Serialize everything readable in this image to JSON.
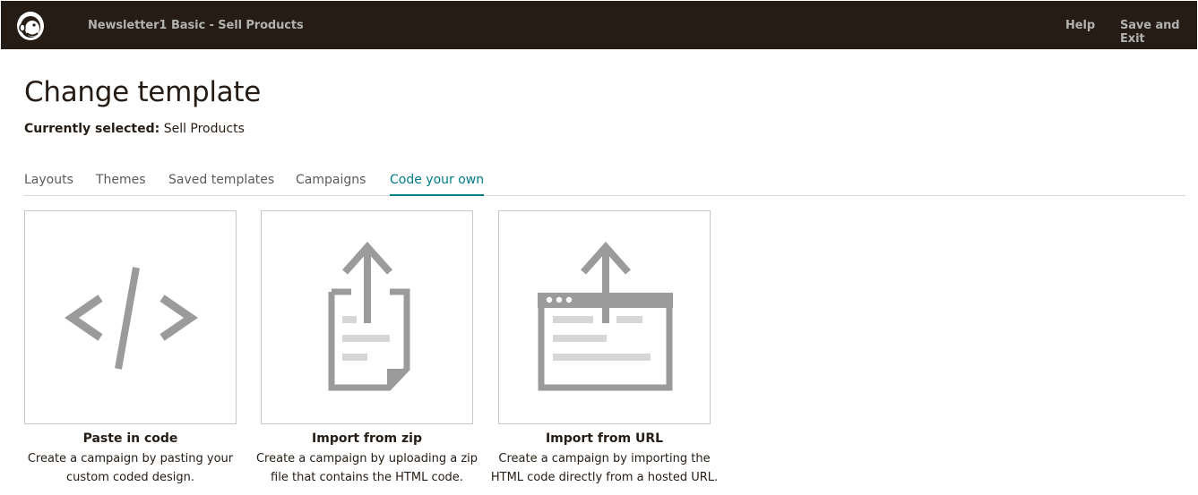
{
  "header": {
    "breadcrumbs": [
      "Newsletter1",
      "Basic - Sell Products"
    ],
    "help_label": "Help",
    "save_exit_label": "Save and Exit"
  },
  "page": {
    "title": "Change template",
    "currently_selected_label": "Currently selected:",
    "currently_selected_value": "Sell Products"
  },
  "tabs": [
    {
      "label": "Layouts"
    },
    {
      "label": "Themes"
    },
    {
      "label": "Saved templates"
    },
    {
      "label": "Campaigns"
    },
    {
      "label": "Code your own",
      "active": true
    }
  ],
  "options": [
    {
      "title": "Paste in code",
      "desc_line1": "Create a campaign by pasting your",
      "desc_line2": "custom coded design.",
      "icon": "code-icon"
    },
    {
      "title": "Import from zip",
      "desc_line1": "Create a campaign by uploading a zip",
      "desc_line2": "file that contains the HTML code.",
      "icon": "upload-file-icon"
    },
    {
      "title": "Import from URL",
      "desc_line1": "Create a campaign by importing the",
      "desc_line2": "HTML code directly from a hosted URL.",
      "icon": "upload-browser-icon"
    }
  ],
  "colors": {
    "topbar": "#241c15",
    "accent": "#007c89",
    "icon_gray": "#9b9b9b",
    "icon_light": "#d6d6d6"
  }
}
